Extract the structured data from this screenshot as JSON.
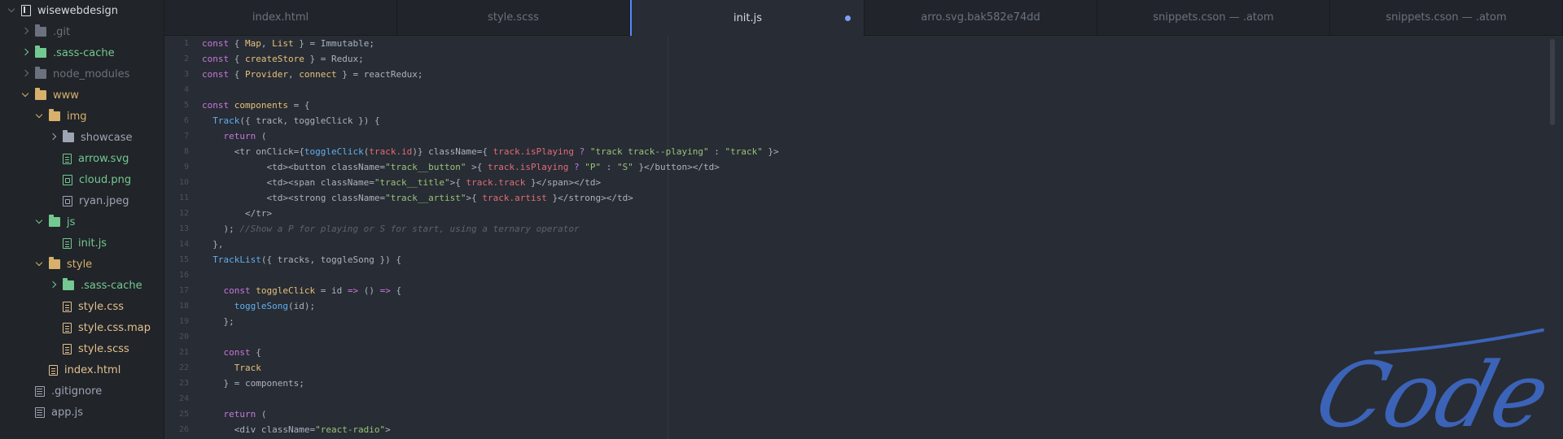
{
  "sidebar": {
    "project": "wisewebdesign",
    "items": [
      {
        "label": ".git",
        "indent": 1,
        "chev": "closed",
        "icon": "folder-icon",
        "color": "dim"
      },
      {
        "label": ".sass-cache",
        "indent": 1,
        "chev": "closed",
        "icon": "folder-icon",
        "color": "green"
      },
      {
        "label": "node_modules",
        "indent": 1,
        "chev": "closed",
        "icon": "folder-icon",
        "color": "dim"
      },
      {
        "label": "www",
        "indent": 1,
        "chev": "open",
        "icon": "folder-icon",
        "color": "folder"
      },
      {
        "label": "img",
        "indent": 2,
        "chev": "open",
        "icon": "folder-icon",
        "color": "folder"
      },
      {
        "label": "showcase",
        "indent": 3,
        "chev": "closed",
        "icon": "folder-icon",
        "color": "default"
      },
      {
        "label": "arrow.svg",
        "indent": 3,
        "chev": "none",
        "icon": "file-icon",
        "color": "green"
      },
      {
        "label": "cloud.png",
        "indent": 3,
        "chev": "none",
        "icon": "image-file-icon",
        "color": "green"
      },
      {
        "label": "ryan.jpeg",
        "indent": 3,
        "chev": "none",
        "icon": "image-file-icon",
        "color": "default"
      },
      {
        "label": "js",
        "indent": 2,
        "chev": "open",
        "icon": "folder-icon",
        "color": "green"
      },
      {
        "label": "init.js",
        "indent": 3,
        "chev": "none",
        "icon": "file-icon",
        "color": "green"
      },
      {
        "label": "style",
        "indent": 2,
        "chev": "open",
        "icon": "folder-icon",
        "color": "folder"
      },
      {
        "label": ".sass-cache",
        "indent": 3,
        "chev": "closed",
        "icon": "folder-icon",
        "color": "green"
      },
      {
        "label": "style.css",
        "indent": 3,
        "chev": "none",
        "icon": "file-icon",
        "color": "orange"
      },
      {
        "label": "style.css.map",
        "indent": 3,
        "chev": "none",
        "icon": "file-icon",
        "color": "orange"
      },
      {
        "label": "style.scss",
        "indent": 3,
        "chev": "none",
        "icon": "file-icon",
        "color": "orange"
      },
      {
        "label": "index.html",
        "indent": 2,
        "chev": "none",
        "icon": "file-icon",
        "color": "orange"
      },
      {
        "label": ".gitignore",
        "indent": 1,
        "chev": "none",
        "icon": "doc-file-icon",
        "color": "default"
      },
      {
        "label": "app.js",
        "indent": 1,
        "chev": "none",
        "icon": "doc-file-icon",
        "color": "default"
      }
    ]
  },
  "tabs": [
    {
      "label": "index.html",
      "active": false
    },
    {
      "label": "style.scss",
      "active": false
    },
    {
      "label": "init.js",
      "active": true,
      "modified": true
    },
    {
      "label": "arro.svg.bak582e74dd",
      "active": false
    },
    {
      "label": "snippets.cson — .atom",
      "active": false
    },
    {
      "label": "snippets.cson — .atom",
      "active": false
    }
  ],
  "editor": {
    "line_numbers": [
      "1",
      "2",
      "3",
      "4",
      "5",
      "6",
      "7",
      "8",
      "9",
      "10",
      "11",
      "12",
      "13",
      "14",
      "15",
      "16",
      "17",
      "18",
      "19",
      "20",
      "21",
      "22",
      "23",
      "24",
      "25",
      "26"
    ],
    "lines": [
      [
        [
          "kw",
          "const"
        ],
        [
          "p",
          " { "
        ],
        [
          "var",
          "Map"
        ],
        [
          "p",
          ", "
        ],
        [
          "var",
          "List"
        ],
        [
          "p",
          " } = Immutable;"
        ]
      ],
      [
        [
          "kw",
          "const"
        ],
        [
          "p",
          " { "
        ],
        [
          "var",
          "createStore"
        ],
        [
          "p",
          " } = Redux;"
        ]
      ],
      [
        [
          "kw",
          "const"
        ],
        [
          "p",
          " { "
        ],
        [
          "var",
          "Provider"
        ],
        [
          "p",
          ", "
        ],
        [
          "var",
          "connect"
        ],
        [
          "p",
          " } = reactRedux;"
        ]
      ],
      [],
      [
        [
          "kw",
          "const"
        ],
        [
          "p",
          " "
        ],
        [
          "var",
          "components"
        ],
        [
          "p",
          " = {"
        ]
      ],
      [
        [
          "p",
          "  "
        ],
        [
          "fn",
          "Track"
        ],
        [
          "p",
          "({ track, toggleClick }) {"
        ]
      ],
      [
        [
          "p",
          "    "
        ],
        [
          "kw",
          "return"
        ],
        [
          "p",
          " ("
        ]
      ],
      [
        [
          "p",
          "      <tr onClick={"
        ],
        [
          "fn",
          "toggleClick"
        ],
        [
          "p",
          "("
        ],
        [
          "prop",
          "track.id"
        ],
        [
          "p",
          ")} className={ "
        ],
        [
          "prop",
          "track.isPlaying"
        ],
        [
          "p",
          " "
        ],
        [
          "kw",
          "?"
        ],
        [
          "p",
          " "
        ],
        [
          "str",
          "\"track track--playing\""
        ],
        [
          "p",
          " : "
        ],
        [
          "str",
          "\"track\""
        ],
        [
          "p",
          " }>"
        ]
      ],
      [
        [
          "p",
          "            <td><button className="
        ],
        [
          "str",
          "\"track__button\""
        ],
        [
          "p",
          " >{ "
        ],
        [
          "prop",
          "track.isPlaying"
        ],
        [
          "p",
          " "
        ],
        [
          "kw",
          "?"
        ],
        [
          "p",
          " "
        ],
        [
          "str",
          "\"P\""
        ],
        [
          "p",
          " : "
        ],
        [
          "str",
          "\"S\""
        ],
        [
          "p",
          " }</button></td>"
        ]
      ],
      [
        [
          "p",
          "            <td><span className="
        ],
        [
          "str",
          "\"track__title\""
        ],
        [
          "p",
          ">{ "
        ],
        [
          "prop",
          "track.track"
        ],
        [
          "p",
          " }</span></td>"
        ]
      ],
      [
        [
          "p",
          "            <td><strong className="
        ],
        [
          "str",
          "\"track__artist\""
        ],
        [
          "p",
          ">{ "
        ],
        [
          "prop",
          "track.artist"
        ],
        [
          "p",
          " }</strong></td>"
        ]
      ],
      [
        [
          "p",
          "        </tr>"
        ]
      ],
      [
        [
          "p",
          "    ); "
        ],
        [
          "cm",
          "//Show a P for playing or S for start, using a ternary operator"
        ]
      ],
      [
        [
          "p",
          "  },"
        ]
      ],
      [
        [
          "p",
          "  "
        ],
        [
          "fn",
          "TrackList"
        ],
        [
          "p",
          "({ tracks, toggleSong }) {"
        ]
      ],
      [],
      [
        [
          "p",
          "    "
        ],
        [
          "kw",
          "const"
        ],
        [
          "p",
          " "
        ],
        [
          "var",
          "toggleClick"
        ],
        [
          "p",
          " = id "
        ],
        [
          "kw",
          "=>"
        ],
        [
          "p",
          " () "
        ],
        [
          "kw",
          "=>"
        ],
        [
          "p",
          " {"
        ]
      ],
      [
        [
          "p",
          "      "
        ],
        [
          "fn",
          "toggleSong"
        ],
        [
          "p",
          "(id);"
        ]
      ],
      [
        [
          "p",
          "    };"
        ]
      ],
      [],
      [
        [
          "p",
          "    "
        ],
        [
          "kw",
          "const"
        ],
        [
          "p",
          " {"
        ]
      ],
      [
        [
          "p",
          "      "
        ],
        [
          "var",
          "Track"
        ]
      ],
      [
        [
          "p",
          "    } = components;"
        ]
      ],
      [],
      [
        [
          "p",
          "    "
        ],
        [
          "kw",
          "return"
        ],
        [
          "p",
          " ("
        ]
      ],
      [
        [
          "p",
          "      <div className="
        ],
        [
          "str",
          "\"react-radio\""
        ],
        [
          "p",
          ">"
        ]
      ]
    ]
  },
  "watermark": "Code"
}
